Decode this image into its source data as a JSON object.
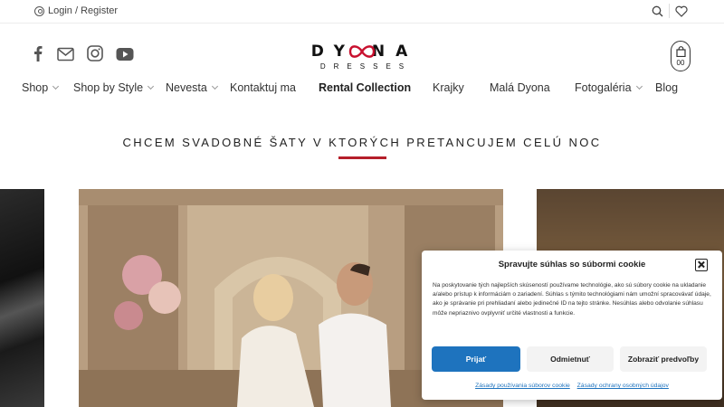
{
  "topbar": {
    "login_label": "Login / Register"
  },
  "social": [
    "facebook-icon",
    "mail-icon",
    "instagram-icon",
    "youtube-icon"
  ],
  "logo": {
    "main": "DY NA",
    "sub": "DRESSES",
    "bow_color": "#c8102e"
  },
  "cart": {
    "count": "00"
  },
  "nav": {
    "items": [
      {
        "label": "Shop",
        "dropdown": true
      },
      {
        "label": "Shop by Style",
        "dropdown": true
      },
      {
        "label": "Nevesta",
        "dropdown": true
      },
      {
        "label": "Kontaktuj ma",
        "dropdown": false
      },
      {
        "label": "Rental Collection",
        "dropdown": false
      },
      {
        "label": "Krajky",
        "dropdown": false
      },
      {
        "label": "Malá Dyona",
        "dropdown": false
      },
      {
        "label": "Fotogaléria",
        "dropdown": true
      },
      {
        "label": "Blog",
        "dropdown": false
      }
    ]
  },
  "headline": "CHCEM SVADOBNÉ ŠATY V KTORÝCH PRETANCUJEM CELÚ NOC",
  "accent": "#b51f2a",
  "cookie": {
    "title": "Spravujte súhlas so súbormi cookie",
    "text": "Na poskytovanie tých najlepších skúseností používame technológie, ako sú súbory cookie na ukladanie a/alebo prístup k informáciám o zariadení. Súhlas s týmito technológiami nám umožní spracovávať údaje, ako je správanie pri prehliadaní alebo jedinečné ID na tejto stránke. Nesúhlas alebo odvolanie súhlasu môže nepriaznivo ovplyvniť určité vlastnosti a funkcie.",
    "accept_label": "Prijať",
    "deny_label": "Odmietnuť",
    "prefs_label": "Zobraziť predvoľby",
    "link_cookie_policy": "Zásady používania súborov cookie",
    "link_privacy": "Zásady ochrany osobných údajov",
    "accent": "#1e73be"
  }
}
